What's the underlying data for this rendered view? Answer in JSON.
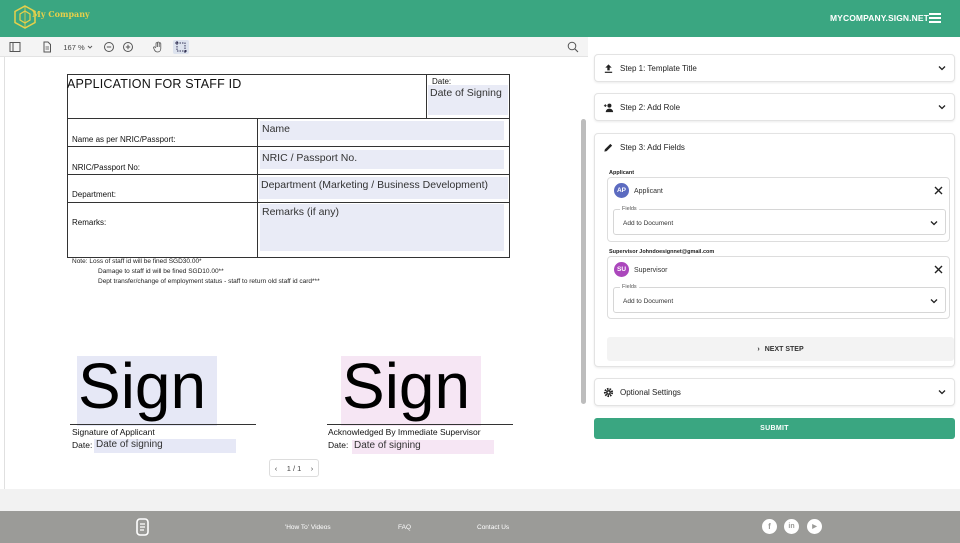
{
  "header": {
    "company_name": "My Company",
    "site_link": "MYCOMPANY.SIGN.NET",
    "brand_color": "#3aa681",
    "logo_color": "#e7d04a"
  },
  "toolbar": {
    "zoom": "167 %",
    "icons": [
      "sidebar-toggle-icon",
      "document-icon",
      "zoom-out-icon",
      "zoom-in-icon",
      "hand-icon",
      "select-icon",
      "search-icon"
    ]
  },
  "document": {
    "title": "APPLICATION  FOR STAFF ID",
    "date_label": "Date:",
    "date_field": "Date of Signing",
    "rows": [
      {
        "label": "Name as per NRIC/Passport:",
        "field": "Name"
      },
      {
        "label": "NRIC/Passport No:",
        "field": "NRIC / Passport No."
      },
      {
        "label": "Department:",
        "field": "Department (Marketing / Business Development)"
      },
      {
        "label": "Remarks:",
        "field": "Remarks (if any)"
      }
    ],
    "notes": [
      "Note:   Loss of staff id will be fined SGD30.00*",
      "Damage to staff id will be fined SGD10.00**",
      "Dept transfer/change of employment status - staff to return old staff id card***"
    ],
    "signatures": [
      {
        "sign": "Sign",
        "caption": "Signature of Applicant",
        "date_label": "Date:",
        "date_field": "Date of signing",
        "color": "#e6e8f6"
      },
      {
        "sign": "Sign",
        "caption": "Acknowledged By Immediate Supervisor",
        "date_label": "Date:",
        "date_field": "Date of signing",
        "color": "#f6e6f4"
      }
    ],
    "pager": "1 / 1"
  },
  "panel": {
    "step1": "Step 1: Template Title",
    "step2": "Step 2: Add Role",
    "step3": "Step 3: Add Fields",
    "applicant_section": "Applicant",
    "applicant": {
      "initials": "AP",
      "name": "Applicant",
      "fields_label": "Fields",
      "fields_value": "Add to Document",
      "color": "#5c6bc0"
    },
    "supervisor_section": "Supervisor Johndoesignnet@gmail.com",
    "supervisor": {
      "initials": "SU",
      "name": "Supervisor",
      "fields_label": "Fields",
      "fields_value": "Add to Document",
      "color": "#ab47bc"
    },
    "next_step": "NEXT STEP",
    "optional": "Optional Settings",
    "submit": "SUBMIT"
  },
  "footer": {
    "links": [
      "'How To' Videos",
      "FAQ",
      "Contact Us"
    ],
    "social": [
      "facebook-icon",
      "linkedin-icon",
      "youtube-icon"
    ]
  }
}
